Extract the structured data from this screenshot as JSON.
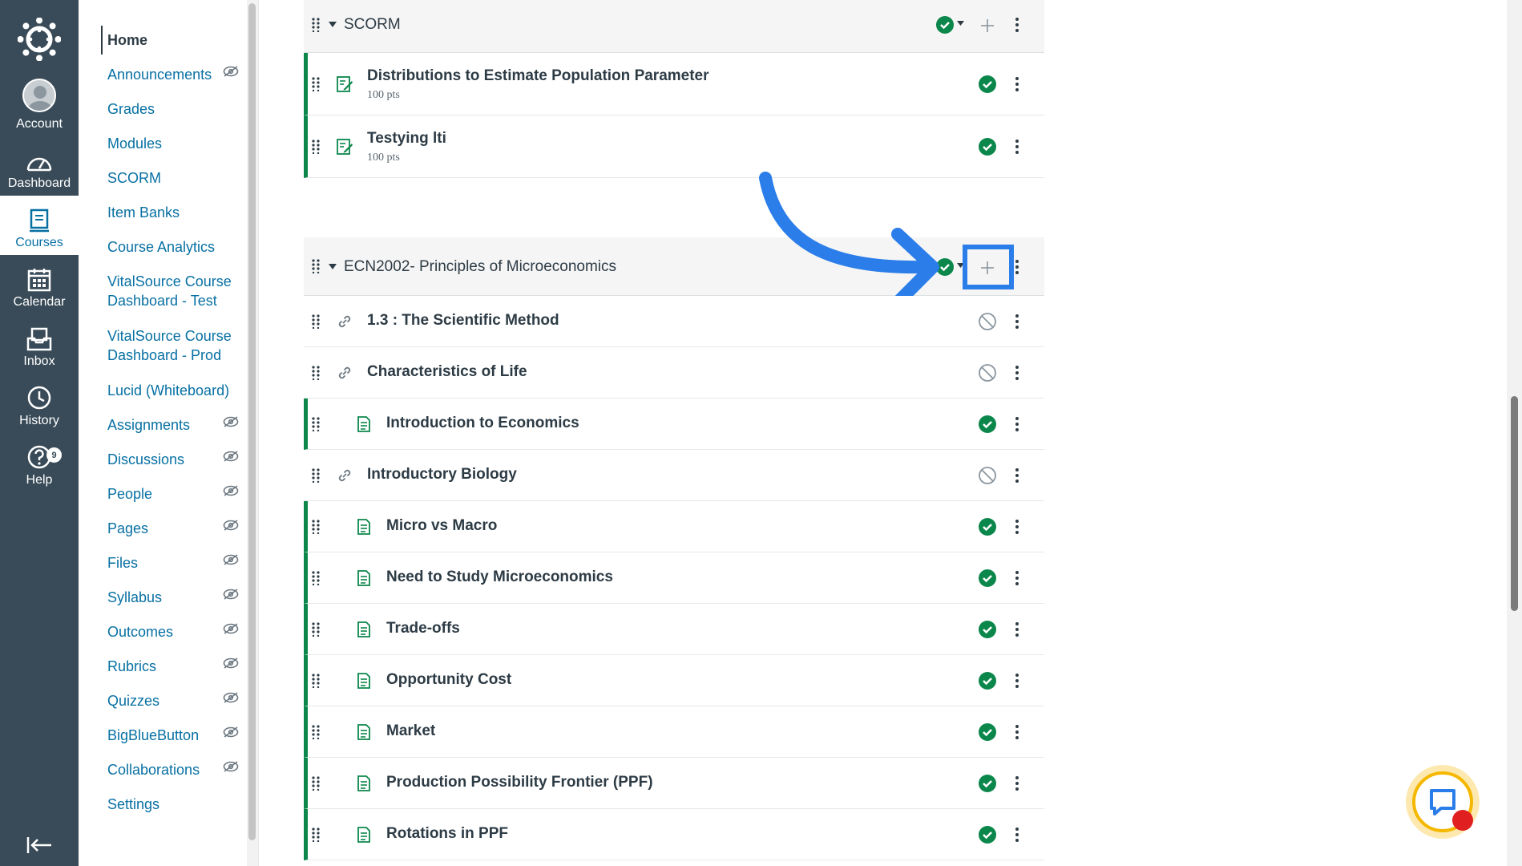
{
  "global_nav": {
    "items": [
      {
        "label": "Account",
        "icon": "avatar"
      },
      {
        "label": "Dashboard",
        "icon": "dashboard-icon"
      },
      {
        "label": "Courses",
        "icon": "courses-icon",
        "active": true
      },
      {
        "label": "Calendar",
        "icon": "calendar-icon"
      },
      {
        "label": "Inbox",
        "icon": "inbox-icon"
      },
      {
        "label": "History",
        "icon": "history-icon"
      },
      {
        "label": "Help",
        "icon": "help-icon",
        "badge": "9"
      }
    ]
  },
  "course_nav": {
    "items": [
      {
        "label": "Home",
        "hidden": false
      },
      {
        "label": "Announcements",
        "hidden": true
      },
      {
        "label": "Grades",
        "hidden": false
      },
      {
        "label": "Modules",
        "hidden": false
      },
      {
        "label": "SCORM",
        "hidden": false
      },
      {
        "label": "Item Banks",
        "hidden": false
      },
      {
        "label": "Course Analytics",
        "hidden": false
      },
      {
        "label": "VitalSource Course Dashboard - Test",
        "hidden": false
      },
      {
        "label": "VitalSource Course Dashboard - Prod",
        "hidden": false
      },
      {
        "label": "Lucid (Whiteboard)",
        "hidden": false
      },
      {
        "label": "Assignments",
        "hidden": true
      },
      {
        "label": "Discussions",
        "hidden": true
      },
      {
        "label": "People",
        "hidden": true
      },
      {
        "label": "Pages",
        "hidden": true
      },
      {
        "label": "Files",
        "hidden": true
      },
      {
        "label": "Syllabus",
        "hidden": true
      },
      {
        "label": "Outcomes",
        "hidden": true
      },
      {
        "label": "Rubrics",
        "hidden": true
      },
      {
        "label": "Quizzes",
        "hidden": true
      },
      {
        "label": "BigBlueButton",
        "hidden": true
      },
      {
        "label": "Collaborations",
        "hidden": true
      },
      {
        "label": "Settings",
        "hidden": false
      }
    ]
  },
  "modules": [
    {
      "title": "SCORM",
      "items": [
        {
          "title": "Distributions to Estimate Population Parameter",
          "points": "100 pts",
          "type": "assignment-icon",
          "status": "published"
        },
        {
          "title": "Testying lti",
          "points": "100 pts",
          "type": "assignment-icon",
          "status": "published"
        }
      ]
    },
    {
      "title": "ECN2002- Principles of Microeconomics",
      "items": [
        {
          "title": "1.3 : The Scientific Method",
          "type": "link-icon",
          "status": "unpublished",
          "indent": 0
        },
        {
          "title": "Characteristics of Life",
          "type": "link-icon",
          "status": "unpublished",
          "indent": 0
        },
        {
          "title": "Introduction to Economics",
          "type": "page-icon",
          "status": "published",
          "indent": 1
        },
        {
          "title": "Introductory Biology",
          "type": "link-icon",
          "status": "unpublished",
          "indent": 0
        },
        {
          "title": "Micro vs Macro",
          "type": "page-icon",
          "status": "published",
          "indent": 1
        },
        {
          "title": "Need to Study Microeconomics",
          "type": "page-icon",
          "status": "published",
          "indent": 1
        },
        {
          "title": "Trade-offs",
          "type": "page-icon",
          "status": "published",
          "indent": 1
        },
        {
          "title": "Opportunity Cost",
          "type": "page-icon",
          "status": "published",
          "indent": 1
        },
        {
          "title": "Market",
          "type": "page-icon",
          "status": "published",
          "indent": 1
        },
        {
          "title": "Production Possibility Frontier (PPF)",
          "type": "page-icon",
          "status": "published",
          "indent": 1
        },
        {
          "title": "Rotations in PPF",
          "type": "page-icon",
          "status": "published",
          "indent": 1
        }
      ]
    }
  ],
  "colors": {
    "nav_bg": "#394b58",
    "link": "#0770a3",
    "published": "#0b874b",
    "annotation": "#2b7de9"
  }
}
